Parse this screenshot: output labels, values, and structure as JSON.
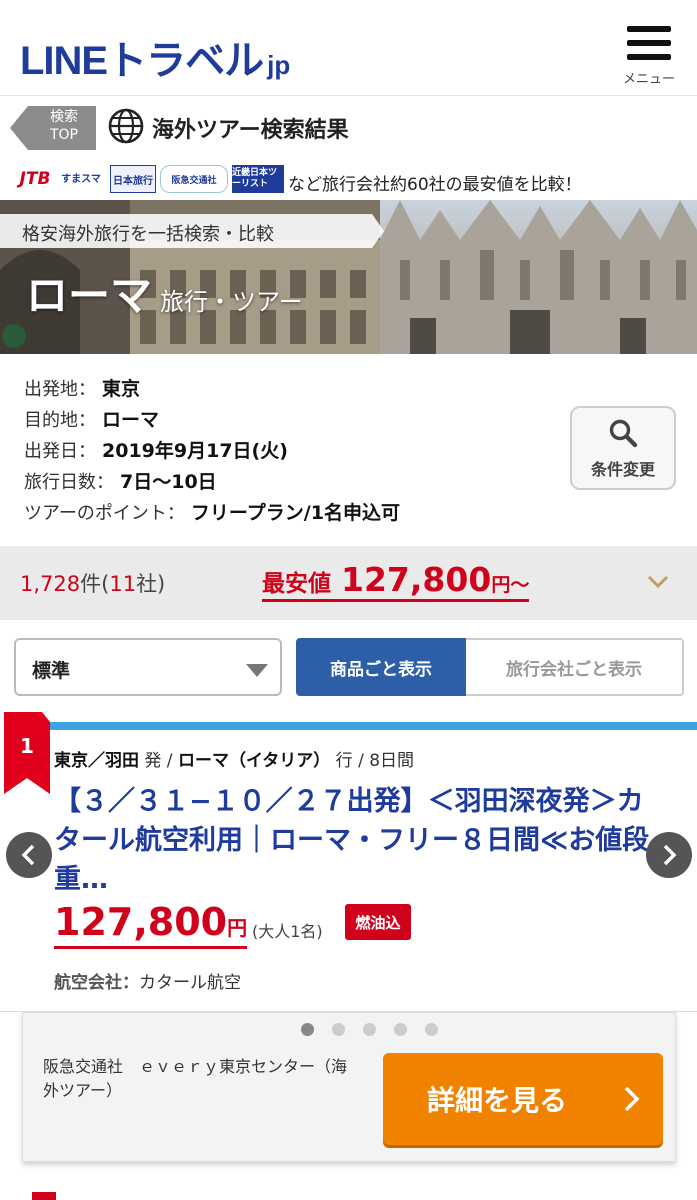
{
  "header": {
    "logo_main": "LINEトラベル",
    "logo_sub": "jp",
    "menu_label": "メニュー"
  },
  "breadcrumb": {
    "back_label_line1": "検索",
    "back_label_line2": "TOP",
    "title": "海外ツアー検索結果"
  },
  "partners": {
    "logos": [
      "JTB",
      "すまスマ",
      "日本旅行",
      "阪急交通社",
      "近畿日本ツーリスト"
    ],
    "text": "など旅行会社約60社の最安値を比較！"
  },
  "hero": {
    "tagline": "格安海外旅行を一括検索・比較",
    "destination": "ローマ",
    "suffix": "旅行・ツアー"
  },
  "conditions": {
    "departure_label": "出発地：",
    "departure_value": "東京",
    "destination_label": "目的地：",
    "destination_value": "ローマ",
    "date_label": "出発日：",
    "date_value": "2019年9月17日(火)",
    "days_label": "旅行日数：",
    "days_value": "7日〜10日",
    "point_label": "ツアーのポイント：",
    "point_value": "フリープラン/1名申込可",
    "change_button": "条件変更"
  },
  "summary": {
    "count": "1,728",
    "count_unit": "件(",
    "companies": "11",
    "companies_unit": "社)",
    "min_label": "最安値",
    "min_price": "127,800",
    "min_unit": "円〜"
  },
  "sort": {
    "selected": "標準",
    "tab_product": "商品ごと表示",
    "tab_company": "旅行会社ごと表示"
  },
  "tour": {
    "rank": "1",
    "from": "東京／羽田",
    "from_suffix": " 発 / ",
    "to": "ローマ（イタリア）",
    "to_suffix": " 行 / 8日間",
    "title": "【３／３１−１０／２７出発】＜羽田深夜発＞カタール航空利用｜ローマ・フリー８日間≪お値段重…",
    "price": "127,800",
    "price_unit": "円",
    "adult": "(大人1名)",
    "fuel_badge": "燃油込",
    "airline_label": "航空会社：",
    "airline_value": "カタール航空",
    "carousel_dots": 5,
    "carousel_active": 0
  },
  "agency": {
    "name": "阪急交通社　ｅｖｅｒｙ東京センター（海外ツアー）",
    "detail_button": "詳細を見る"
  },
  "colors": {
    "brand_blue": "#1f3b9b",
    "price_red": "#d0021b",
    "accent_orange": "#f08200",
    "tab_blue": "#2c5fa8",
    "card_line": "#3aa3e0"
  }
}
